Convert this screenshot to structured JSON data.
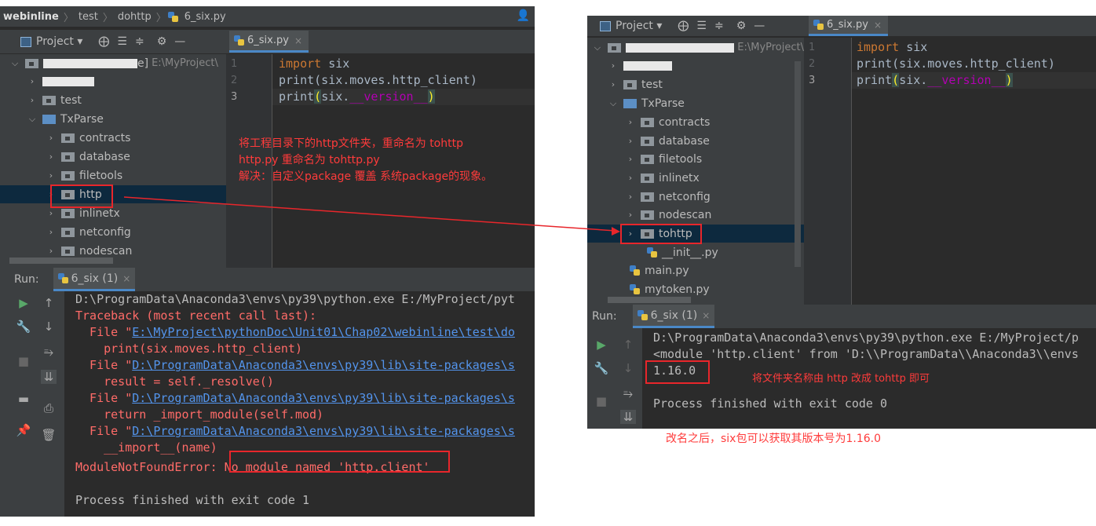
{
  "left": {
    "breadcrumb": [
      "webinline",
      "test",
      "dohttp",
      "6_six.py"
    ],
    "toolbar": {
      "project_label": "Project ▾",
      "icons": [
        "target-icon",
        "collapse-icon",
        "expand-icon",
        "gear-icon",
        "minimize-icon"
      ]
    },
    "tab": {
      "label": "6_six.py",
      "close": "×"
    },
    "tree": {
      "root_suffix": "e]",
      "root_path": "E:\\MyProject\\",
      "items": [
        {
          "label": "test"
        },
        {
          "label": "TxParse"
        },
        {
          "label": "contracts"
        },
        {
          "label": "database"
        },
        {
          "label": "filetools"
        },
        {
          "label": "http"
        },
        {
          "label": "inlinetx"
        },
        {
          "label": "netconfig"
        },
        {
          "label": "nodescan"
        }
      ]
    },
    "gutter": [
      "1",
      "2",
      "3"
    ],
    "code": {
      "l1_kw": "import",
      "l1_rest": " six",
      "l2": "print(six.moves.http_client)",
      "l3_a": "print",
      "l3_b": "(",
      "l3_c": "six.",
      "l3_d": "__version__",
      "l3_e": ")"
    },
    "annotation": [
      "将工程目录下的http文件夹，重命名为 tohttp",
      "http.py 重命名为 tohttp.py",
      "解决：自定义package 覆盖 系统package的现象。"
    ],
    "run": {
      "label": "Run:",
      "tab": "6_six (1)",
      "close": "×"
    },
    "console": {
      "l1": "D:\\ProgramData\\Anaconda3\\envs\\py39\\python.exe E:/MyProject/pyt",
      "l2": "Traceback (most recent call last):",
      "l3_a": "  File \"",
      "l3_link": "E:\\MyProject\\pythonDoc\\Unit01\\Chap02\\webinline\\test\\do",
      "l4": "    print(six.moves.http_client)",
      "l5_a": "  File \"",
      "l5_link": "D:\\ProgramData\\Anaconda3\\envs\\py39\\lib\\site-packages\\s",
      "l6": "    result = self._resolve()",
      "l7_a": "  File \"",
      "l7_link": "D:\\ProgramData\\Anaconda3\\envs\\py39\\lib\\site-packages\\s",
      "l8": "    return _import_module(self.mod)",
      "l9_a": "  File \"",
      "l9_link": "D:\\ProgramData\\Anaconda3\\envs\\py39\\lib\\site-packages\\s",
      "l10": "    __import__(name)",
      "l11_a": "ModuleNotFoundError: ",
      "l11_b": "No module named 'http.client'",
      "l12": "Process finished with exit code 1"
    }
  },
  "right": {
    "toolbar": {
      "project_label": "Project ▾"
    },
    "tab": {
      "label": "6_six.py",
      "close": "×"
    },
    "tree": {
      "root_path": "E:\\MyProject\\",
      "items": [
        {
          "label": "test"
        },
        {
          "label": "TxParse"
        },
        {
          "label": "contracts"
        },
        {
          "label": "database"
        },
        {
          "label": "filetools"
        },
        {
          "label": "inlinetx"
        },
        {
          "label": "netconfig"
        },
        {
          "label": "nodescan"
        },
        {
          "label": "tohttp"
        },
        {
          "label": "__init__.py"
        },
        {
          "label": "main.py"
        },
        {
          "label": "mytoken.py"
        }
      ]
    },
    "gutter": [
      "1",
      "2",
      "3"
    ],
    "run": {
      "label": "Run:",
      "tab": "6_six (1)",
      "close": "×"
    },
    "console": {
      "l1": "D:\\ProgramData\\Anaconda3\\envs\\py39\\python.exe E:/MyProject/p",
      "l2": "<module 'http.client' from 'D:\\\\ProgramData\\\\Anaconda3\\\\envs",
      "l3": "1.16.0",
      "l4": "Process finished with exit code 0"
    },
    "annotation": "将文件夹名称由 http 改成 tohttp 即可"
  },
  "caption": "改名之后，six包可以获取其版本号为1.16.0",
  "colors": {
    "annotation": "#ff3b3b",
    "box": "#e8262b",
    "keyword": "#cc7832",
    "dunder": "#b200b2",
    "link": "#5394ec",
    "error": "#ff6b68"
  }
}
